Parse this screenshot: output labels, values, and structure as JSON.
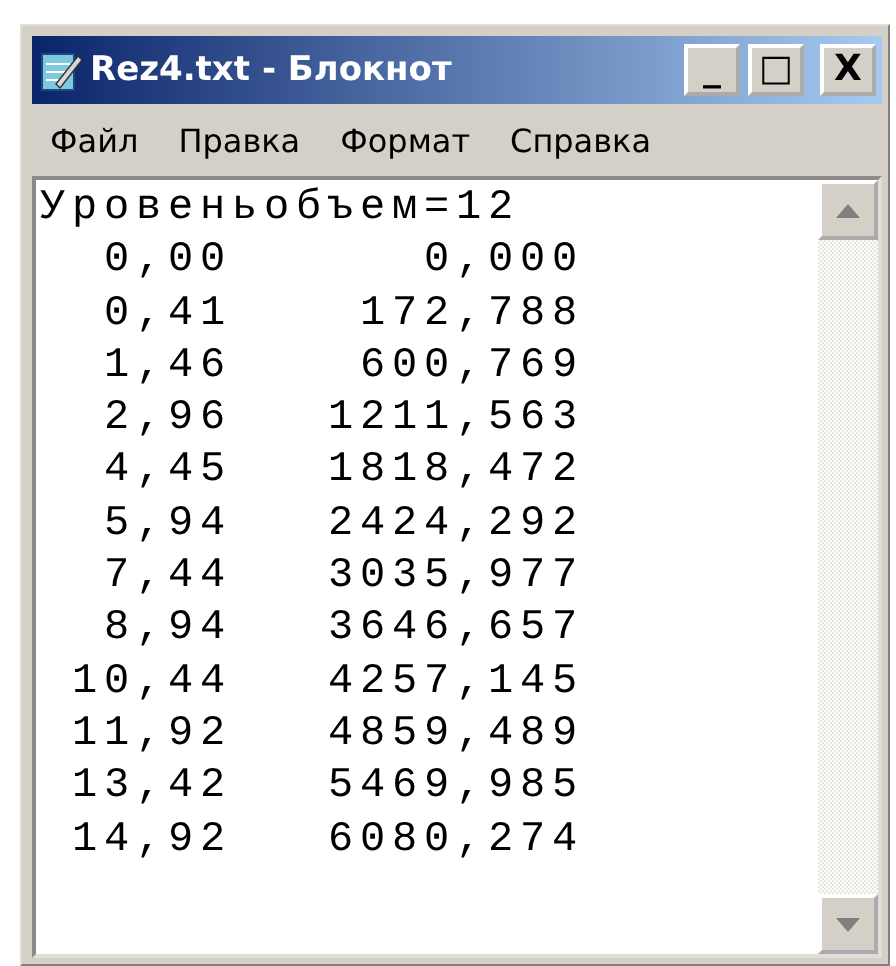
{
  "window": {
    "title": "Rez4.txt - Блокнот",
    "controls": [
      "_",
      "□",
      "X"
    ]
  },
  "menu": [
    "Файл",
    "Правка",
    "Формат",
    "Справка"
  ],
  "document": {
    "header": "Уровеньобъем=12",
    "rows": [
      {
        "level": "0,00",
        "volume": "0,000"
      },
      {
        "level": "0,41",
        "volume": "172,788"
      },
      {
        "level": "1,46",
        "volume": "600,769"
      },
      {
        "level": "2,96",
        "volume": "1211,563"
      },
      {
        "level": "4,45",
        "volume": "1818,472"
      },
      {
        "level": "5,94",
        "volume": "2424,292"
      },
      {
        "level": "7,44",
        "volume": "3035,977"
      },
      {
        "level": "8,94",
        "volume": "3646,657"
      },
      {
        "level": "10,44",
        "volume": "4257,145"
      },
      {
        "level": "11,92",
        "volume": "4859,489"
      },
      {
        "level": "13,42",
        "volume": "5469,985"
      },
      {
        "level": "14,92",
        "volume": "6080,274"
      }
    ]
  }
}
